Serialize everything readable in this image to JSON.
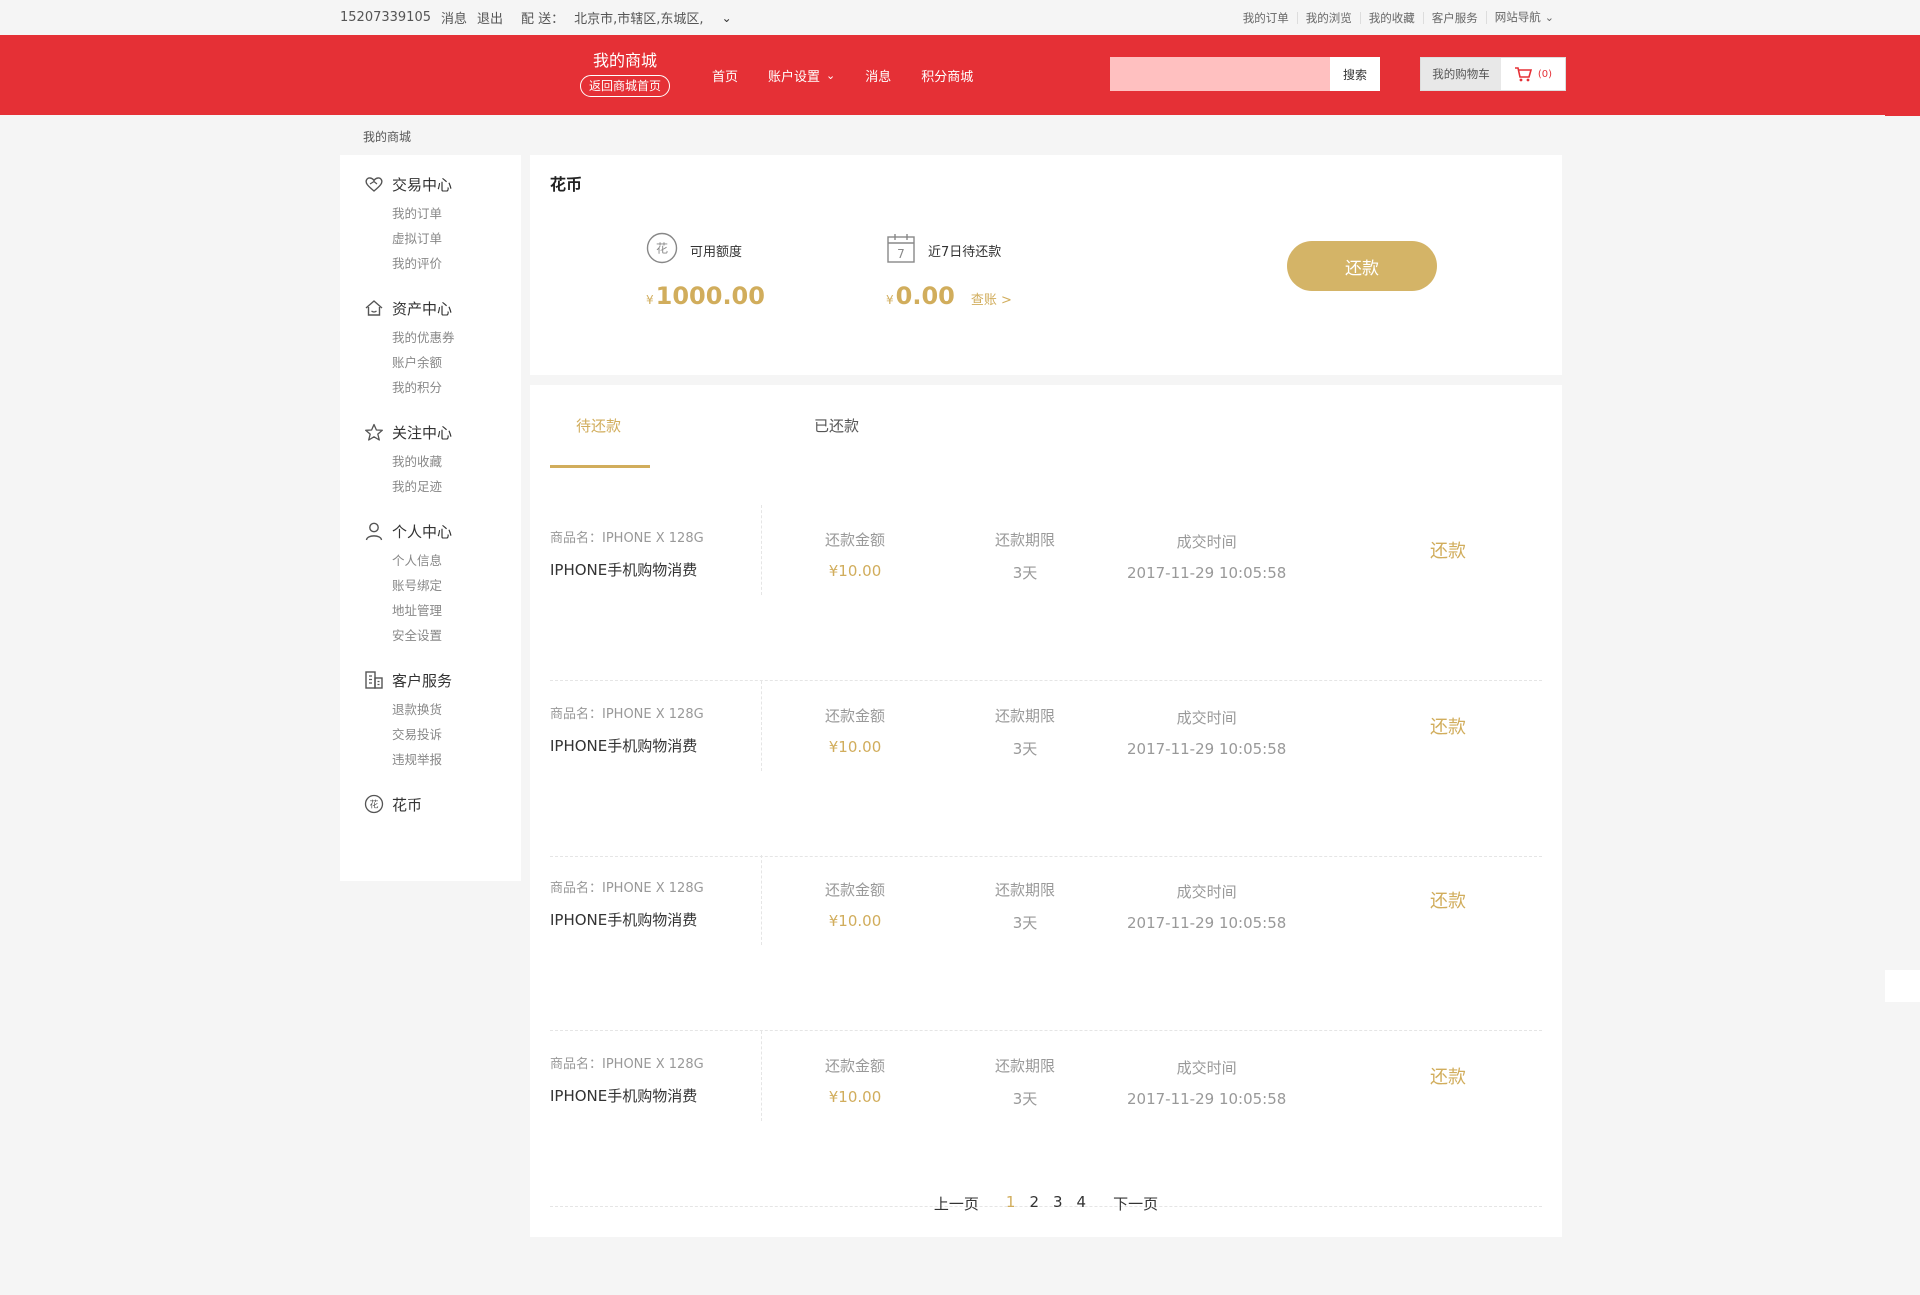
{
  "topbar": {
    "phone": "15207339105",
    "messages": "消息",
    "logout": "退出",
    "delivery_label": "配  送：",
    "delivery_address": "北京市,市辖区,东城区,",
    "links": [
      "我的订单",
      "我的浏览",
      "我的收藏",
      "客户服务",
      "网站导航"
    ]
  },
  "header": {
    "brand_title": "我的商城",
    "brand_back": "返回商城首页",
    "nav": [
      "首页",
      "账户设置",
      "消息",
      "积分商城"
    ],
    "search_placeholder": "",
    "search_button": "搜索",
    "cart_label": "我的购物车",
    "cart_count": "(0)"
  },
  "breadcrumb": "我的商城",
  "sidebar": [
    {
      "title": "交易中心",
      "icon": "heart-hands-icon",
      "items": [
        "我的订单",
        "虚拟订单",
        "我的评价"
      ]
    },
    {
      "title": "资产中心",
      "icon": "house-icon",
      "items": [
        "我的优惠券",
        "账户余额",
        "我的积分"
      ]
    },
    {
      "title": "关注中心",
      "icon": "star-icon",
      "items": [
        "我的收藏",
        "我的足迹"
      ]
    },
    {
      "title": "个人中心",
      "icon": "person-icon",
      "items": [
        "个人信息",
        "账号绑定",
        "地址管理",
        "安全设置"
      ]
    },
    {
      "title": "客户服务",
      "icon": "building-icon",
      "items": [
        "退款换货",
        "交易投诉",
        "违规举报"
      ]
    },
    {
      "title": "花币",
      "icon": "hua-coin-icon",
      "items": []
    }
  ],
  "huabi": {
    "title": "花币",
    "available_label": "可用额度",
    "available_currency": "¥",
    "available_amount": "1000.00",
    "due7_label": "近7日待还款",
    "due7_currency": "¥",
    "due7_amount": "0.00",
    "check_link": "查账 >",
    "repay_button": "还款",
    "coin_glyph": "花",
    "calendar_day": "7"
  },
  "tabs": [
    "待还款",
    "已还款"
  ],
  "records": [
    {
      "model": "商品名：IPHONE  X  128G",
      "name": "IPHONE手机购物消费",
      "amount_label": "还款金额",
      "amount": "¥10.00",
      "term_label": "还款期限",
      "term": "3天",
      "time_label": "成交时间",
      "time": "2017-11-29  10:05:58",
      "action": "还款"
    },
    {
      "model": "商品名：IPHONE  X  128G",
      "name": "IPHONE手机购物消费",
      "amount_label": "还款金额",
      "amount": "¥10.00",
      "term_label": "还款期限",
      "term": "3天",
      "time_label": "成交时间",
      "time": "2017-11-29  10:05:58",
      "action": "还款"
    },
    {
      "model": "商品名：IPHONE  X  128G",
      "name": "IPHONE手机购物消费",
      "amount_label": "还款金额",
      "amount": "¥10.00",
      "term_label": "还款期限",
      "term": "3天",
      "time_label": "成交时间",
      "time": "2017-11-29  10:05:58",
      "action": "还款"
    },
    {
      "model": "商品名：IPHONE  X  128G",
      "name": "IPHONE手机购物消费",
      "amount_label": "还款金额",
      "amount": "¥10.00",
      "term_label": "还款期限",
      "term": "3天",
      "time_label": "成交时间",
      "time": "2017-11-29  10:05:58",
      "action": "还款"
    }
  ],
  "pager": {
    "prev": "上一页",
    "pages": [
      "1",
      "2",
      "3",
      "4"
    ],
    "current": "1",
    "next": "下一页"
  },
  "colors": {
    "brand_red": "#e53036",
    "gold": "#d1ad5c"
  }
}
